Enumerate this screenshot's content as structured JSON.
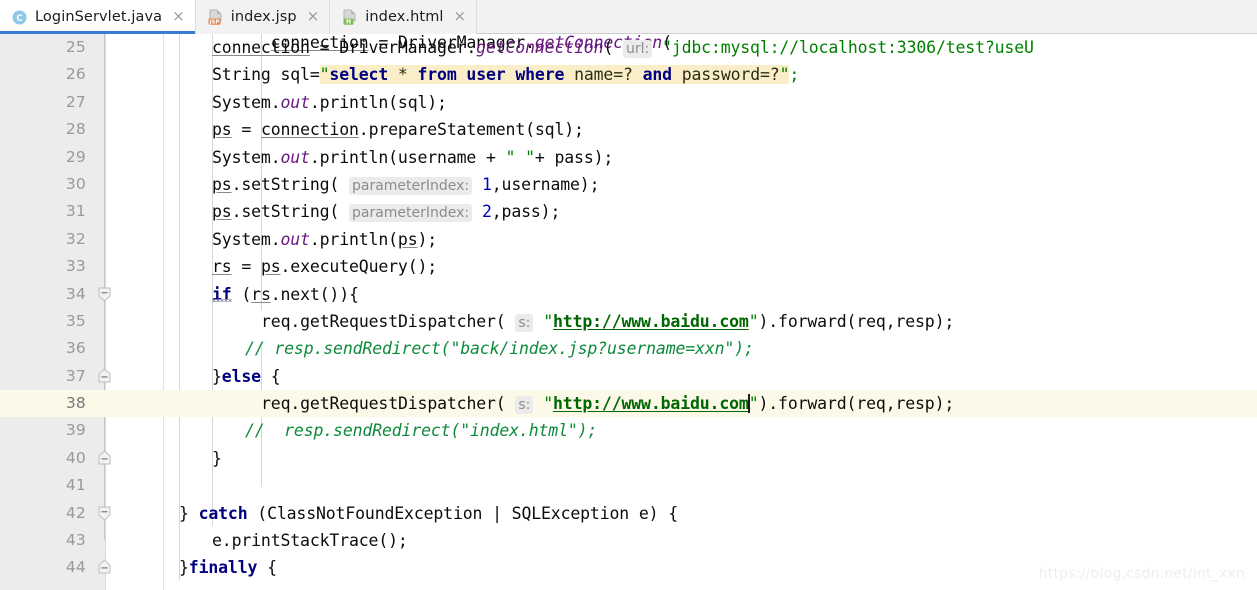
{
  "window": {
    "app": "IntelliJ IDEA Editor",
    "watermark": "https://blog.csdn.net/int_xxn"
  },
  "tabs": [
    {
      "label": "LoginServlet.java",
      "icon": "java-class-icon",
      "badge": "C",
      "badge_color": "#7fc3e8",
      "active": true,
      "close_label": "×"
    },
    {
      "label": "index.jsp",
      "icon": "jsp-file-icon",
      "badge": "JSP",
      "badge_color": "#f0864a",
      "active": false,
      "close_label": "×"
    },
    {
      "label": "index.html",
      "icon": "html-file-icon",
      "badge": "H",
      "badge_color": "#80bd5c",
      "active": false,
      "close_label": "×"
    }
  ],
  "editor": {
    "caret_line": 38,
    "first_line": 25,
    "last_line": 44,
    "colors": {
      "keyword": "#000080",
      "string": "#008000",
      "comment": "#0f8a3c",
      "static_field": "#67197d",
      "number": "#0000c0",
      "sql_highlight_bg": "#faeec8",
      "caret_line_bg": "#fdf9e8",
      "gutter_bg": "#ececec",
      "line_number": "#999999",
      "tab_active_underline": "#3a7bd5"
    },
    "lines": [
      {
        "n": "25",
        "text": "connection = DriverManager.getConnection( url: \"jdbc:mysql://localhost:3306/test?useU"
      },
      {
        "n": "26",
        "text": "String sql=\"select * from user where name=? and password=?\";"
      },
      {
        "n": "27",
        "text": "System.out.println(sql);"
      },
      {
        "n": "28",
        "text": "ps = connection.prepareStatement(sql);"
      },
      {
        "n": "29",
        "text": "System.out.println(username + \" \"+ pass);"
      },
      {
        "n": "30",
        "text": "ps.setString( parameterIndex: 1,username);"
      },
      {
        "n": "31",
        "text": "ps.setString( parameterIndex: 2,pass);"
      },
      {
        "n": "32",
        "text": "System.out.println(ps);"
      },
      {
        "n": "33",
        "text": "rs = ps.executeQuery();"
      },
      {
        "n": "34",
        "text": "if (rs.next()){"
      },
      {
        "n": "35",
        "text": "    req.getRequestDispatcher( s: \"http://www.baidu.com\").forward(req,resp);"
      },
      {
        "n": "36",
        "text": "  // resp.sendRedirect(\"back/index.jsp?username=xxn\");"
      },
      {
        "n": "37",
        "text": "}else {"
      },
      {
        "n": "38",
        "text": "    req.getRequestDispatcher( s: \"http://www.baidu.com\").forward(req,resp);"
      },
      {
        "n": "39",
        "text": "  //  resp.sendRedirect(\"index.html\");"
      },
      {
        "n": "40",
        "text": "}"
      },
      {
        "n": "41",
        "text": ""
      },
      {
        "n": "42",
        "text": "} catch (ClassNotFoundException | SQLException e) {"
      },
      {
        "n": "43",
        "text": "    e.printStackTrace();"
      },
      {
        "n": "44",
        "text": "}finally {"
      }
    ],
    "hints": {
      "url_param": "url:",
      "parameter_index": "parameterIndex:",
      "s_param": "s:"
    },
    "fold_markers": [
      {
        "line": "34",
        "type": "fold-start-icon"
      },
      {
        "line": "37",
        "type": "fold-end-icon"
      },
      {
        "line": "40",
        "type": "fold-end-icon"
      },
      {
        "line": "42",
        "type": "fold-start-icon"
      },
      {
        "line": "44",
        "type": "fold-end-icon"
      }
    ]
  }
}
